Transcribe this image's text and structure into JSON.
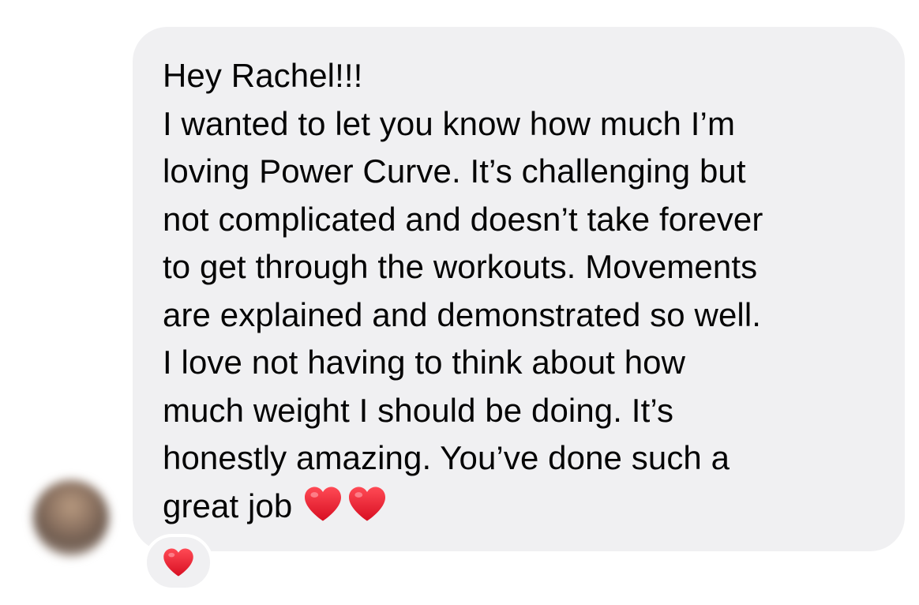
{
  "message": {
    "lines": [
      "Hey Rachel!!!",
      "I wanted to let you know how much I’m",
      "loving Power Curve. It’s challenging but",
      "not complicated and doesn’t take forever",
      "to get through the workouts. Movements",
      "are explained and demonstrated so well.",
      "I love not having to think about how",
      "much weight I should be doing. It’s",
      "honestly amazing. You’ve done such a",
      "great job"
    ],
    "trailing_emoji": [
      "red-heart",
      "red-heart"
    ]
  },
  "reaction": {
    "emoji": "red-heart"
  },
  "colors": {
    "bubble": "#f0f0f2",
    "text": "#050505",
    "heart": "#e0182d"
  }
}
